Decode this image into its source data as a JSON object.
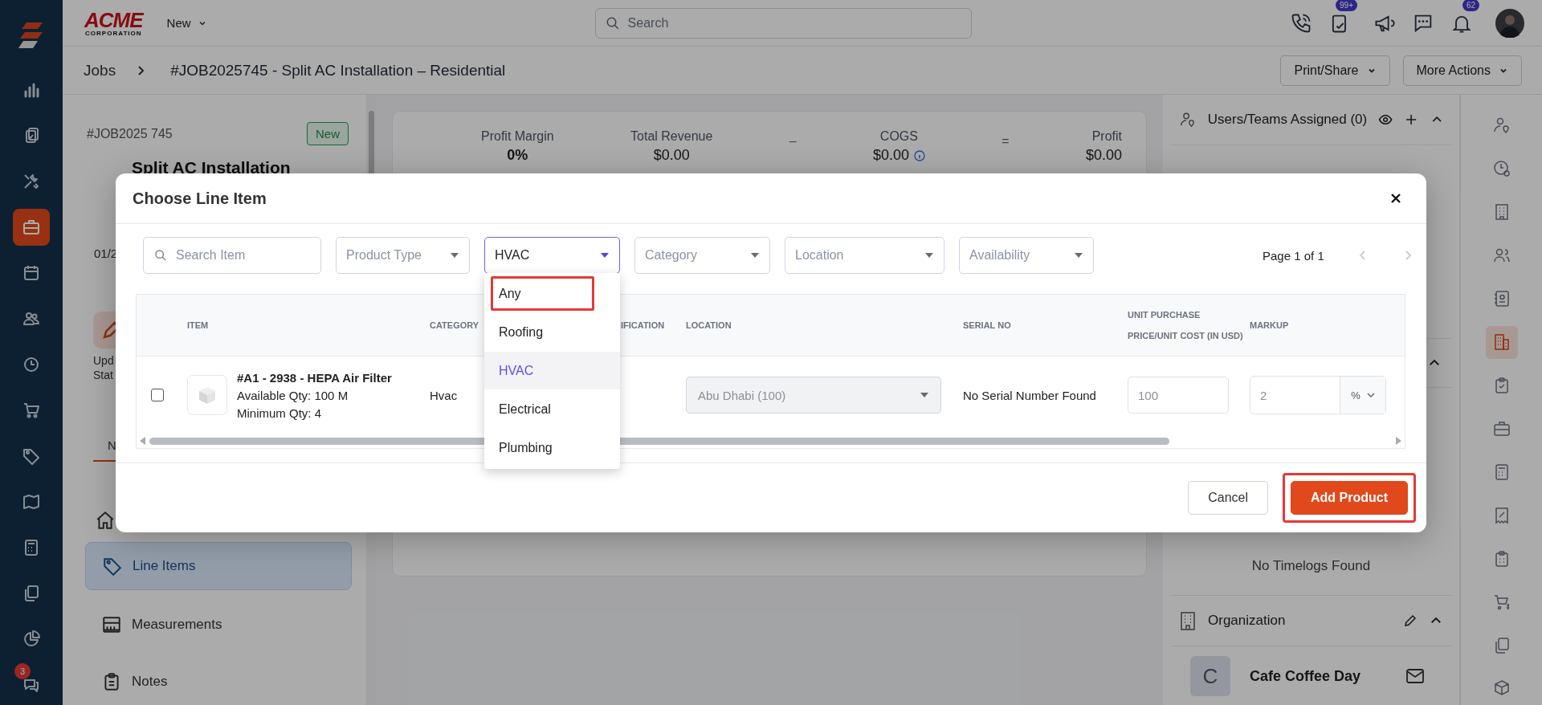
{
  "app_nav": {
    "items": [
      {
        "selected": false
      },
      {
        "selected": false
      },
      {
        "selected": false
      },
      {
        "selected": true
      },
      {
        "selected": false
      },
      {
        "selected": false
      },
      {
        "selected": false
      },
      {
        "selected": false
      },
      {
        "selected": false
      },
      {
        "selected": false
      },
      {
        "selected": false
      },
      {
        "selected": false
      },
      {
        "selected": false
      },
      {
        "selected": false
      }
    ],
    "chat_badge": "3"
  },
  "top_bar": {
    "logo": {
      "title": "ACME",
      "subtitle": "CORPORATION"
    },
    "new_menu": "New",
    "search": {
      "placeholder": "Search"
    },
    "task_badge": "99+",
    "notification_badge": "62"
  },
  "breadcrumb": {
    "parent": "Jobs",
    "title": "#JOB2025745 - Split AC Installation – Residential"
  },
  "actions": [
    "Print/Share",
    "More Actions"
  ],
  "job_panel": {
    "number": "#JOB2025 745",
    "status": "New",
    "name": "Split AC Installation",
    "date": "01/2",
    "update_action": [
      "Upd",
      "Stat"
    ],
    "tab": "N",
    "menu": [
      {
        "label": "Line Items",
        "selected": true
      },
      {
        "label": "Measurements",
        "selected": false
      },
      {
        "label": "Notes",
        "selected": false
      }
    ]
  },
  "summary": {
    "metrics": [
      {
        "label": "Profit Margin",
        "value": "0%",
        "kind": "bold"
      },
      {
        "label": "Total Revenue",
        "value": "$0.00",
        "kind": "plain"
      },
      {
        "label": "COGS",
        "value": "$0.00",
        "kind": "info"
      },
      {
        "label": "Profit",
        "value": "$0.00",
        "kind": "plain"
      }
    ],
    "operators": [
      "–",
      "="
    ]
  },
  "right_panel": {
    "assigned_title": "Users/Teams Assigned (0)",
    "timelogs_empty": "No Timelogs Found",
    "organization": {
      "title": "Organization",
      "initial": "C",
      "name": "Cafe Coffee Day"
    }
  },
  "right_rail": [
    {
      "selected": false
    },
    {
      "selected": false
    },
    {
      "selected": false
    },
    {
      "selected": false
    },
    {
      "selected": false
    },
    {
      "selected": true
    },
    {
      "selected": false
    },
    {
      "selected": false
    },
    {
      "selected": false
    },
    {
      "selected": false
    },
    {
      "selected": false
    },
    {
      "selected": false
    },
    {
      "selected": false
    },
    {
      "selected": false
    }
  ],
  "modal": {
    "title": "Choose Line Item",
    "filters": [
      {
        "kind": "search",
        "placeholder": "Search Item"
      },
      {
        "kind": "select",
        "placeholder": "Product Type"
      },
      {
        "kind": "select",
        "value": "HVAC",
        "expanded": true,
        "options": [
          {
            "label": "Any",
            "selected": false,
            "highlighted": true
          },
          {
            "label": "Roofing",
            "selected": false,
            "highlighted": false
          },
          {
            "label": "HVAC",
            "selected": true,
            "highlighted": false
          },
          {
            "label": "Electrical",
            "selected": false,
            "highlighted": false
          },
          {
            "label": "Plumbing",
            "selected": false,
            "highlighted": false
          }
        ]
      },
      {
        "kind": "select",
        "placeholder": "Category"
      },
      {
        "kind": "select",
        "placeholder": "Location"
      },
      {
        "kind": "select",
        "placeholder": "Availability"
      }
    ],
    "pagination": {
      "label": "Page 1 of 1",
      "prev_disabled": true,
      "next_disabled": true
    },
    "columns": [
      "ITEM",
      "CATEGORY",
      "IFICATION",
      "LOCATION",
      "SERIAL NO",
      "UNIT PURCHASE PRICE/UNIT COST (IN USD)",
      "MARKUP"
    ],
    "rows": [
      {
        "checked": false,
        "name": "#A1 - 2938 - HEPA Air Filter",
        "available": "Available Qty: 100 M",
        "minimum": "Minimum Qty: 4",
        "category": "Hvac",
        "location": "Abu Dhabi (100)",
        "location_disabled": true,
        "serial": "No Serial Number Found",
        "unit_cost": "100",
        "markup": "2",
        "markup_unit": "%"
      }
    ],
    "buttons": [
      {
        "label": "Cancel",
        "kind": "secondary",
        "highlighted": false
      },
      {
        "label": "Add Product",
        "kind": "primary",
        "highlighted": true
      }
    ]
  }
}
